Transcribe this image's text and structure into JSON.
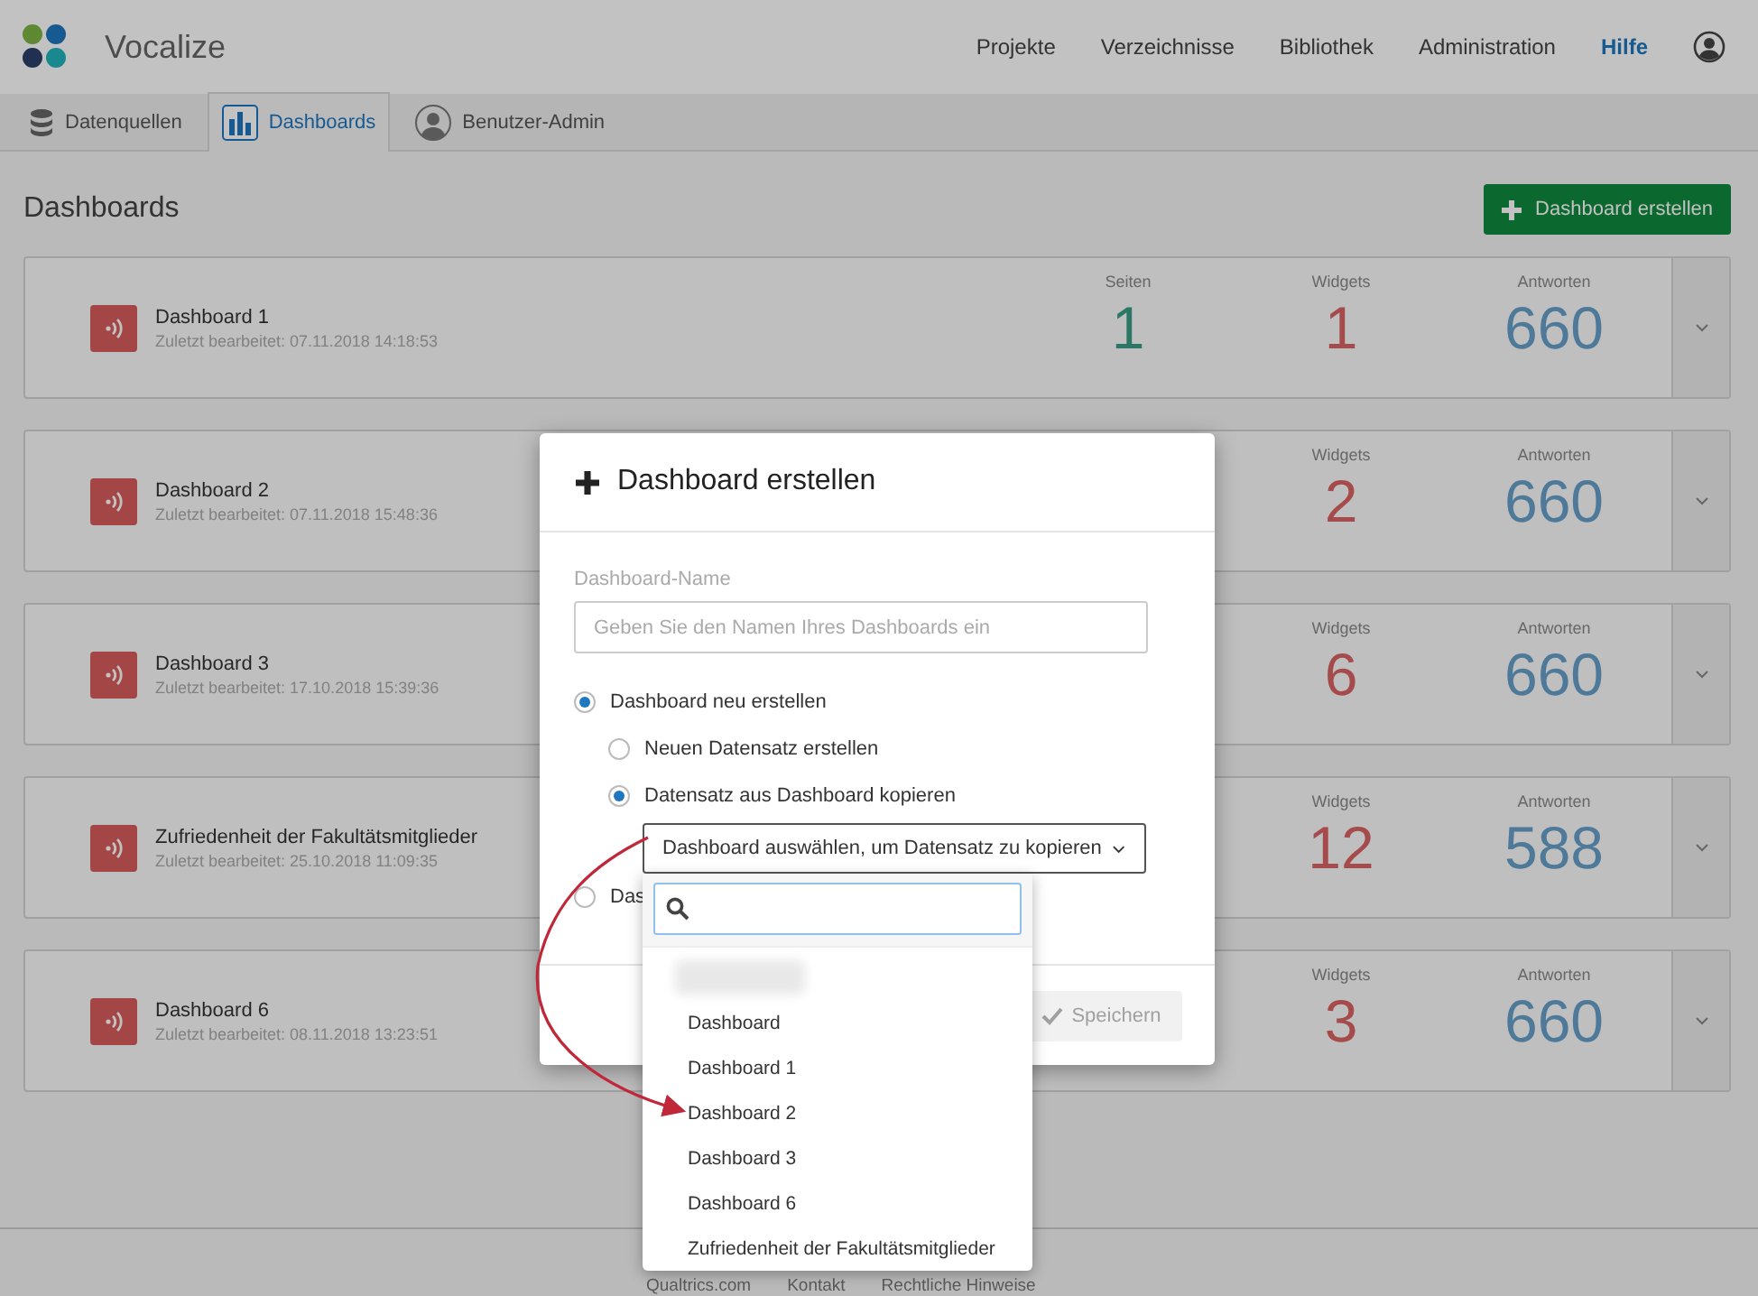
{
  "app": {
    "name": "Vocalize"
  },
  "nav": [
    {
      "label": "Projekte",
      "selected": false
    },
    {
      "label": "Verzeichnisse",
      "selected": false
    },
    {
      "label": "Bibliothek",
      "selected": false
    },
    {
      "label": "Administration",
      "selected": false
    },
    {
      "label": "Hilfe",
      "selected": true
    }
  ],
  "tabs": [
    {
      "label": "Datenquellen",
      "kind": "database",
      "selected": false
    },
    {
      "label": "Dashboards",
      "kind": "chart",
      "selected": true
    },
    {
      "label": "Benutzer-Admin",
      "kind": "user",
      "selected": false
    }
  ],
  "page_title": "Dashboards",
  "create_button": "Dashboard erstellen",
  "dashboards": [
    {
      "name": "Dashboard 1",
      "edited": "Zuletzt bearbeitet: 07.11.2018 14:18:53",
      "stats": [
        {
          "label": "Seiten",
          "value": "1",
          "kind": "pages"
        },
        {
          "label": "Widgets",
          "value": "1",
          "kind": "widgets"
        },
        {
          "label": "Antworten",
          "value": "660",
          "kind": "responses"
        }
      ]
    },
    {
      "name": "Dashboard 2",
      "edited": "Zuletzt bearbeitet: 07.11.2018 15:48:36",
      "stats": [
        {
          "label": "Widgets",
          "value": "2",
          "kind": "widgets"
        },
        {
          "label": "Antworten",
          "value": "660",
          "kind": "responses"
        }
      ]
    },
    {
      "name": "Dashboard 3",
      "edited": "Zuletzt bearbeitet: 17.10.2018 15:39:36",
      "stats": [
        {
          "label": "Widgets",
          "value": "6",
          "kind": "widgets"
        },
        {
          "label": "Antworten",
          "value": "660",
          "kind": "responses"
        }
      ]
    },
    {
      "name": "Zufriedenheit der Fakultätsmitglieder",
      "edited": "Zuletzt bearbeitet: 25.10.2018 11:09:35",
      "stats": [
        {
          "label": "Widgets",
          "value": "12",
          "kind": "widgets"
        },
        {
          "label": "Antworten",
          "value": "588",
          "kind": "responses"
        }
      ]
    },
    {
      "name": "Dashboard 6",
      "edited": "Zuletzt bearbeitet: 08.11.2018 13:23:51",
      "stats": [
        {
          "label": "Widgets",
          "value": "3",
          "kind": "widgets"
        },
        {
          "label": "Antworten",
          "value": "660",
          "kind": "responses"
        }
      ]
    }
  ],
  "modal": {
    "title": "Dashboard erstellen",
    "name_label": "Dashboard-Name",
    "name_placeholder": "Geben Sie den Namen Ihres Dashboards ein",
    "options": [
      {
        "label": "Dashboard neu erstellen",
        "selected": true,
        "children": [
          {
            "label": "Neuen Datensatz erstellen",
            "selected": false
          },
          {
            "label": "Datensatz aus Dashboard kopieren",
            "selected": true
          }
        ]
      },
      {
        "label": "Das",
        "selected": false
      }
    ],
    "select_label": "Dashboard auswählen, um Datensatz zu kopieren",
    "save_button": {
      "label": "Speichern",
      "disabled": true
    }
  },
  "dropdown": {
    "items": [
      {
        "kind": "redacted"
      },
      {
        "kind": "item",
        "label": "Dashboard"
      },
      {
        "kind": "item",
        "label": "Dashboard 1"
      },
      {
        "kind": "item",
        "label": "Dashboard 2"
      },
      {
        "kind": "item",
        "label": "Dashboard 3"
      },
      {
        "kind": "item",
        "label": "Dashboard 6"
      },
      {
        "kind": "item",
        "label": "Zufriedenheit der Fakultätsmitglieder"
      }
    ]
  },
  "footer_links": [
    "Qualtrics.com",
    "Kontakt",
    "Rechtliche Hinweise"
  ]
}
